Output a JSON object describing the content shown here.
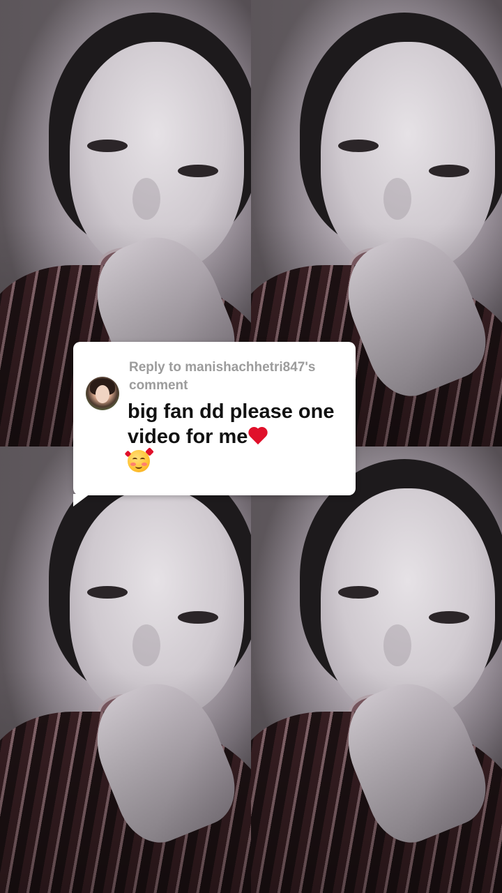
{
  "reply": {
    "label": "Reply to manishachhetri847's comment",
    "comment_text": "big fan dd please one video for me",
    "emoji_heart": "red-heart",
    "emoji_face": "smiling-face-with-hearts"
  },
  "colors": {
    "card_background": "#ffffff",
    "label_gray": "#9c9c9c",
    "comment_black": "#111111",
    "heart_red": "#e0102a"
  }
}
